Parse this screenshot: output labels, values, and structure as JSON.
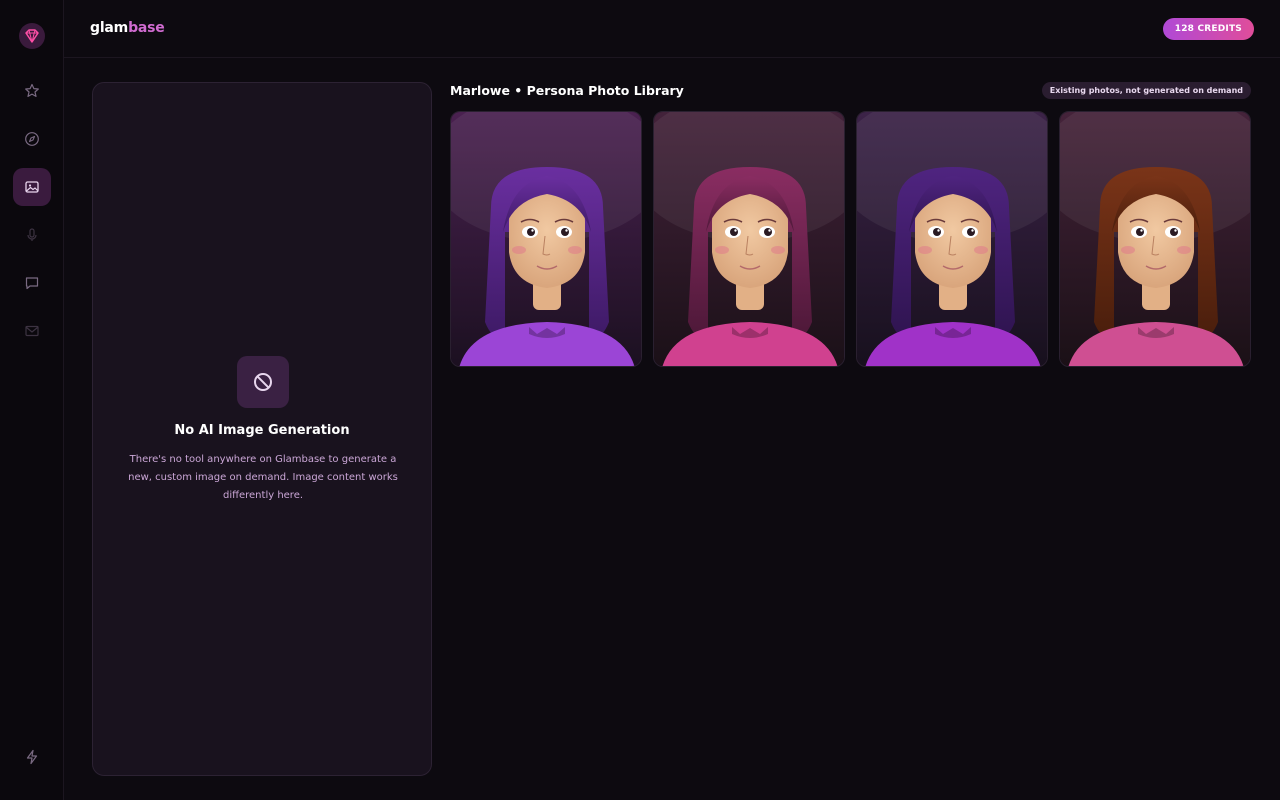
{
  "app": {
    "brand_part1": "glam",
    "brand_part2": "base",
    "credits": "128 CREDITS"
  },
  "rail": {
    "items": [
      {
        "icon": "star-icon",
        "active": false
      },
      {
        "icon": "compass-icon",
        "active": false
      },
      {
        "icon": "image-icon",
        "active": true
      },
      {
        "icon": "microphone-icon",
        "active": false
      },
      {
        "icon": "chat-icon",
        "active": false
      },
      {
        "icon": "mail-icon",
        "active": false
      }
    ],
    "bottom_icon": "lightning-icon"
  },
  "notice": {
    "icon": "block-icon",
    "title": "No AI Image Generation",
    "description": "There's no tool anywhere on Glambase to generate a new, custom image on demand. Image content works differently here."
  },
  "library": {
    "title": "Marlowe • Persona Photo Library",
    "badge": "Existing photos, not generated on demand",
    "photos": [
      {
        "hair": "#6a2fa0",
        "hair_dark": "#3e1a66",
        "top": "#9b45d6",
        "bg1": "#4a2150",
        "bg2": "#1b1020"
      },
      {
        "hair": "#8a2d62",
        "hair_dark": "#4d1838",
        "top": "#d0418f",
        "bg1": "#43223a",
        "bg2": "#1a1017"
      },
      {
        "hair": "#4f2480",
        "hair_dark": "#2f1450",
        "top": "#a032c8",
        "bg1": "#3c2348",
        "bg2": "#17101d"
      },
      {
        "hair": "#7a3418",
        "hair_dark": "#4a1e0c",
        "top": "#cf4f92",
        "bg1": "#45233a",
        "bg2": "#1a1016"
      }
    ]
  },
  "colors": {
    "accent": "#d06bd0",
    "background": "#0d0a10",
    "panel": "#19121e"
  }
}
